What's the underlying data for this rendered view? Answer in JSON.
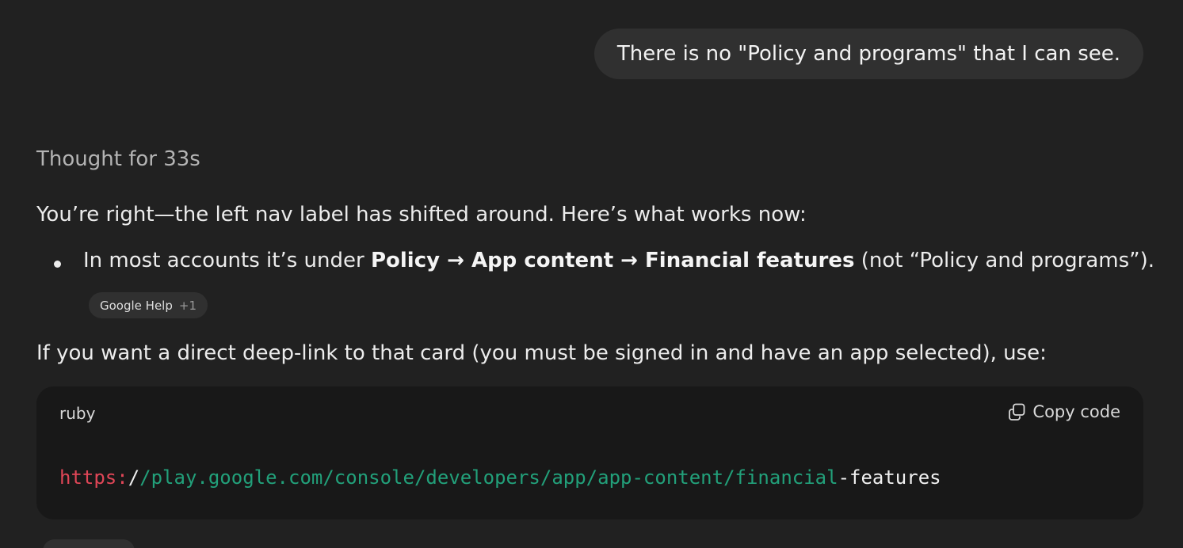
{
  "user_message": {
    "text": "There is no \"Policy and programs\" that I can see."
  },
  "assistant": {
    "thought_label": "Thought for 33s",
    "intro": "You’re right—the left nav label has shifted around. Here’s what works now:",
    "bullet": {
      "prefix": "In most accounts it’s under ",
      "path_bold": "Policy → App content → Financial features",
      "suffix": " (not “Policy and programs”)."
    },
    "source_chip": {
      "label": "Google Help",
      "count": "+1"
    },
    "deeplink_text": "If you want a direct deep-link to that card (you must be signed in and have an app selected), use:",
    "code_block": {
      "language": "ruby",
      "copy_label": "Copy code",
      "copy_icon": "copy-icon",
      "tokens": {
        "proto": "https:",
        "slash": "/",
        "path": "/play.google.com/console/developers/app/app-content/financial",
        "tail": "-features"
      }
    }
  },
  "colors": {
    "background": "#212121",
    "user_bubble": "#303030",
    "code_bg": "#181818",
    "code_proto": "#e04657",
    "code_path": "#22a07a"
  }
}
